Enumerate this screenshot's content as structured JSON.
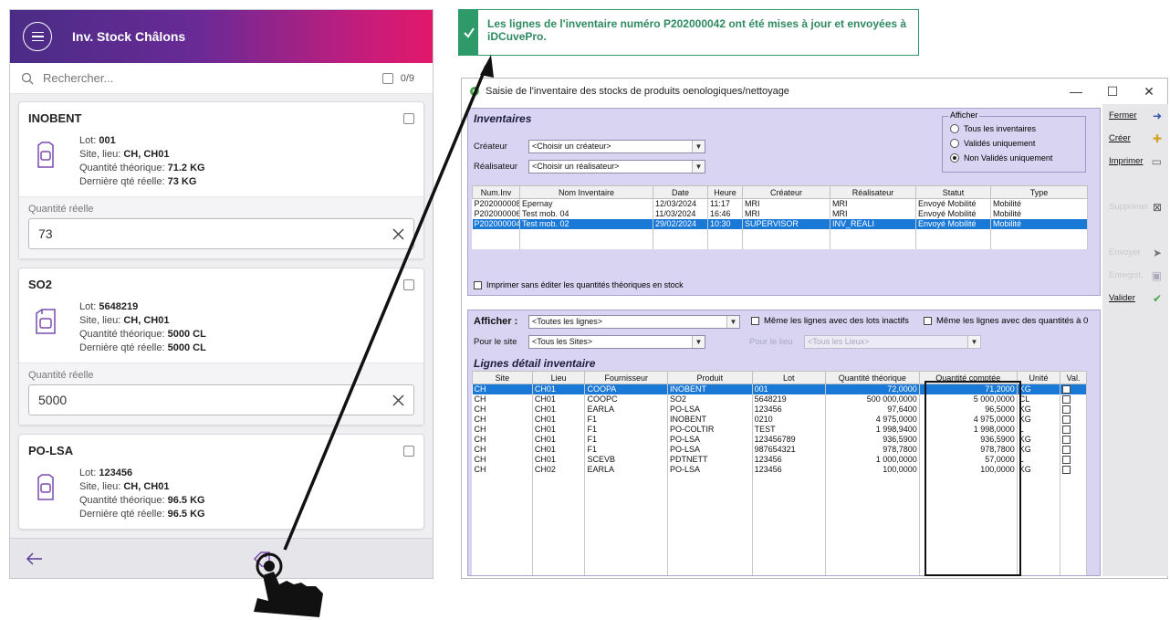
{
  "mobile": {
    "title": "Inv. Stock Châlons",
    "search_placeholder": "Rechercher...",
    "count": "0/9",
    "qty_label": "Quantité réelle",
    "cards": [
      {
        "name": "INOBENT",
        "lot_label": "Lot: ",
        "lot": "001",
        "site_label": "Site, lieu: ",
        "site": "CH, CH01",
        "qt_label": "Quantité théorique: ",
        "qt": "71.2 KG",
        "last_label": "Dernière qté réelle: ",
        "last": "73 KG",
        "qty": "73"
      },
      {
        "name": "SO2",
        "lot_label": "Lot: ",
        "lot": "5648219",
        "site_label": "Site, lieu: ",
        "site": "CH, CH01",
        "qt_label": "Quantité théorique: ",
        "qt": "5000 CL",
        "last_label": "Dernière qté réelle: ",
        "last": "5000 CL",
        "qty": "5000"
      },
      {
        "name": "PO-LSA",
        "lot_label": "Lot: ",
        "lot": "123456",
        "site_label": "Site, lieu: ",
        "site": "CH, CH01",
        "qt_label": "Quantité théorique: ",
        "qt": "96.5 KG",
        "last_label": "Dernière qté réelle: ",
        "last": "96.5 KG"
      }
    ]
  },
  "notification": {
    "text": "Les lignes de l'inventaire numéro P202000042 ont été mises à jour et envoyées à iDCuvePro."
  },
  "window": {
    "title": "Saisie de l'inventaire des stocks de produits oenologiques/nettoyage",
    "inventaires_title": "Inventaires",
    "createur_label": "Créateur",
    "createur_value": "<Choisir un créateur>",
    "realisateur_label": "Réalisateur",
    "realisateur_value": "<Choisir un réalisateur>",
    "afficher_group": "Afficher",
    "radios": [
      "Tous les inventaires",
      "Validés uniquement",
      "Non Validés uniquement"
    ],
    "inv_columns": [
      "Num.Inv",
      "Nom Inventaire",
      "Date",
      "Heure",
      "Créateur",
      "Réalisateur",
      "Statut",
      "Type"
    ],
    "inv_rows": [
      [
        "P202000008",
        "Epernay",
        "12/03/2024",
        "11:17",
        "MRI",
        "MRI",
        "Envoyé Mobilité",
        "Mobilité"
      ],
      [
        "P202000006",
        "Test mob. 04",
        "11/03/2024",
        "16:46",
        "MRI",
        "MRI",
        "Envoyé Mobilité",
        "Mobilité"
      ],
      [
        "P202000004",
        "Test mob. 02",
        "29/02/2024",
        "10:30",
        "SUPERVISOR",
        "INV_REALI",
        "Envoyé Mobilité",
        "Mobilité"
      ]
    ],
    "print_check": "Imprimer sans éditer les quantités théoriques en stock",
    "afficher_label": "Afficher :",
    "afficher_value": "<Toutes les lignes>",
    "check_lots": "Même les lignes avec des lots inactifs",
    "check_qty": "Même les lignes avec des quantités à 0",
    "site_label": "Pour le site",
    "site_value": "<Tous les Sites>",
    "lieu_label": "Pour le lieu",
    "lieu_value": "<Tous les Lieux>",
    "lines_title": "Lignes détail inventaire",
    "line_columns": [
      "Site",
      "Lieu",
      "Fournisseur",
      "Produit",
      "Lot",
      "Quantité théorique",
      "Quantité comptée",
      "Unité",
      "Val."
    ],
    "line_rows": [
      [
        "CH",
        "CH01",
        "COOPA",
        "INOBENT",
        "001",
        "72,0000",
        "71,2000",
        "KG"
      ],
      [
        "CH",
        "CH01",
        "COOPC",
        "SO2",
        "5648219",
        "500 000,0000",
        "5 000,0000",
        "CL"
      ],
      [
        "CH",
        "CH01",
        "EARLA",
        "PO-LSA",
        "123456",
        "97,6400",
        "96,5000",
        "KG"
      ],
      [
        "CH",
        "CH01",
        "F1",
        "INOBENT",
        "0210",
        "4 975,0000",
        "4 975,0000",
        "KG"
      ],
      [
        "CH",
        "CH01",
        "F1",
        "PO-COLTIR",
        "TEST",
        "1 998,9400",
        "1 998,0000",
        "L"
      ],
      [
        "CH",
        "CH01",
        "F1",
        "PO-LSA",
        "123456789",
        "936,5900",
        "936,5900",
        "KG"
      ],
      [
        "CH",
        "CH01",
        "F1",
        "PO-LSA",
        "987654321",
        "978,7800",
        "978,7800",
        "KG"
      ],
      [
        "CH",
        "CH01",
        "SCEVB",
        "PDTNETT",
        "123456",
        "1 000,0000",
        "57,0000",
        "L"
      ],
      [
        "CH",
        "CH02",
        "EARLA",
        "PO-LSA",
        "123456",
        "100,0000",
        "100,0000",
        "KG"
      ]
    ],
    "side_buttons": [
      {
        "label": "Fermer",
        "disabled": false,
        "icon": "exit-icon"
      },
      {
        "label": "Créer",
        "disabled": false,
        "icon": "create-icon"
      },
      {
        "label": "Imprimer",
        "disabled": false,
        "icon": "printer-icon"
      },
      {
        "label": "Supprimer",
        "disabled": true,
        "icon": "delete-icon"
      },
      {
        "label": "Envoyer",
        "disabled": true,
        "icon": "send-icon"
      },
      {
        "label": "Enregist.",
        "disabled": true,
        "icon": "save-icon"
      },
      {
        "label": "Valider",
        "disabled": false,
        "icon": "check-icon"
      }
    ]
  },
  "colors": {
    "accent_green": "#2e9a6a",
    "selection_blue": "#1a78d6",
    "panel_lavender": "#d8d4f2",
    "header_purple": "#4a2c86",
    "header_pink": "#e2186a"
  }
}
